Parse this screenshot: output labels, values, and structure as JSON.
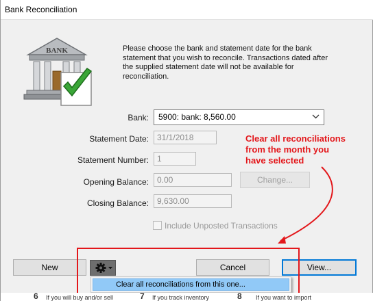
{
  "window": {
    "title": "Bank Reconciliation"
  },
  "intro": {
    "text": "Please choose the bank and statement date for the bank statement that you wish to reconcile.  Transactions dated after the supplied statement date will not be available for reconciliation."
  },
  "illustration": {
    "sign_text": "BANK",
    "icon": "bank-building-with-checkmark-icon"
  },
  "form": {
    "bank_label": "Bank:",
    "bank_value": "5900: bank: 8,560.00",
    "statement_date_label": "Statement Date:",
    "statement_date_value": "31/1/2018",
    "statement_number_label": "Statement Number:",
    "statement_number_value": "1",
    "opening_balance_label": "Opening Balance:",
    "opening_balance_value": "0.00",
    "change_label": "Change...",
    "closing_balance_label": "Closing Balance:",
    "closing_balance_value": "9,630.00",
    "include_unposted_label": "Include Unposted Transactions"
  },
  "buttons": {
    "new_label": "New",
    "cancel_label": "Cancel",
    "view_label": "View..."
  },
  "menu": {
    "item_label": "Clear all reconciliations from this one..."
  },
  "annotation": {
    "text_lines": [
      "Clear all reconciliations",
      "from the month you",
      "have selected"
    ],
    "color": "#e3171b"
  },
  "background_strip": {
    "items": [
      {
        "num": "6",
        "text": "If you will buy and/or sell"
      },
      {
        "num": "7",
        "text": "If you track inventory"
      },
      {
        "num": "8",
        "text": "If you want to import"
      }
    ]
  },
  "colors": {
    "dialog_bg": "#f0f0f0",
    "focus_blue": "#0078d7",
    "menu_highlight": "#91c9f7",
    "annotation_red": "#e3171b"
  }
}
